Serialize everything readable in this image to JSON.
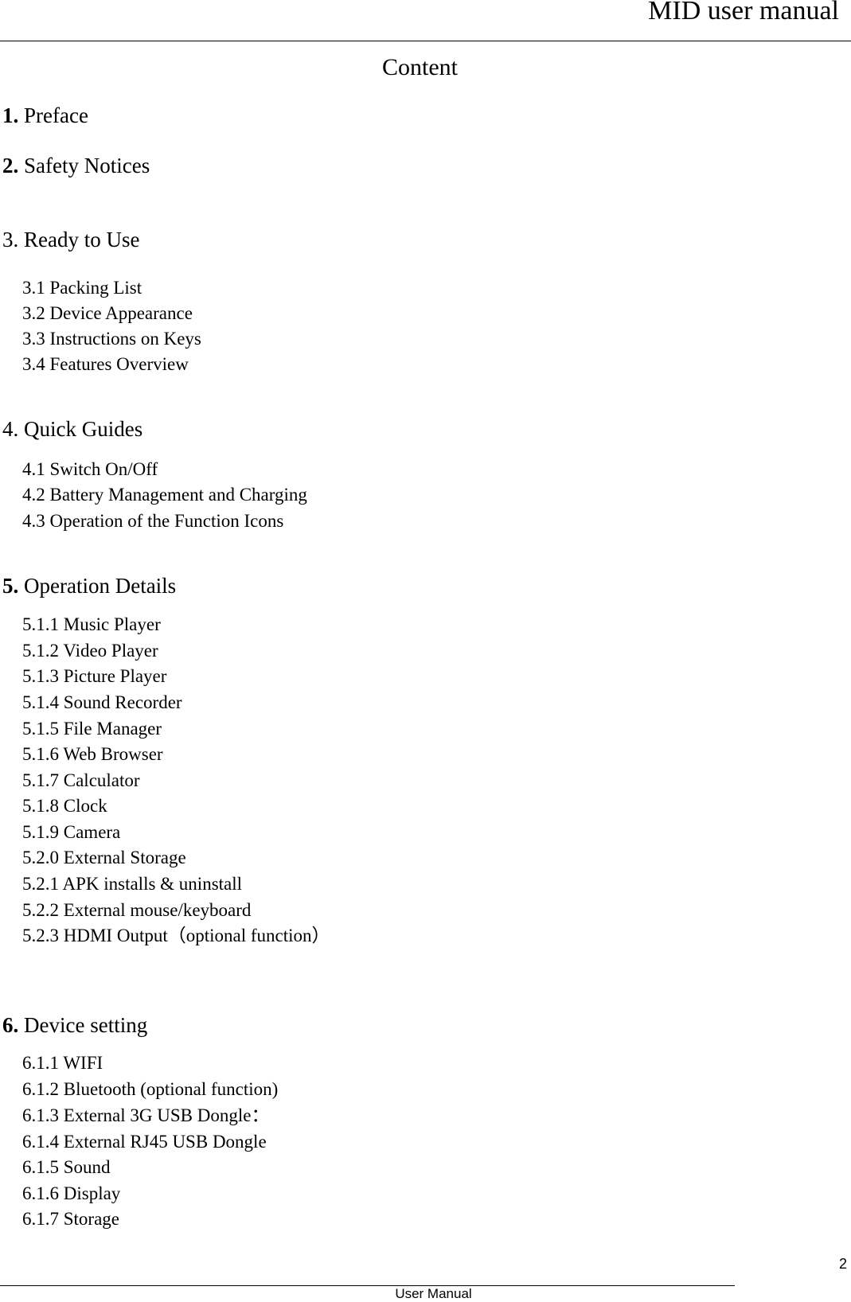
{
  "header": {
    "title": "MID user manual"
  },
  "toc": {
    "title": "Content",
    "sections": [
      {
        "number": "1.",
        "number_bold": true,
        "title": "Preface",
        "items": []
      },
      {
        "number": "2.",
        "number_bold": true,
        "title": "Safety Notices",
        "items": []
      },
      {
        "number": "3.",
        "number_bold": false,
        "title": "Ready to Use",
        "items": [
          "3.1 Packing List",
          "3.2 Device Appearance",
          "3.3 Instructions on Keys",
          "3.4 Features Overview"
        ]
      },
      {
        "number": "4.",
        "number_bold": false,
        "title": "Quick Guides",
        "items": [
          "4.1 Switch On/Off",
          "4.2 Battery Management and Charging",
          "4.3 Operation of the Function Icons"
        ]
      },
      {
        "number": "5.",
        "number_bold": true,
        "title": "Operation Details",
        "items": [
          "5.1.1 Music Player",
          "5.1.2 Video Player",
          "5.1.3 Picture Player",
          "5.1.4 Sound Recorder",
          "5.1.5 File Manager",
          "5.1.6 Web Browser",
          "5.1.7 Calculator",
          "5.1.8 Clock",
          "5.1.9 Camera",
          "5.2.0 External Storage",
          "5.2.1 APK installs & uninstall",
          "5.2.2 External mouse/keyboard",
          "5.2.3 HDMI Output（optional function）"
        ]
      },
      {
        "number": "6.",
        "number_bold": true,
        "title": "Device setting",
        "items": [
          "6.1.1 WIFI",
          "6.1.2 Bluetooth (optional function)",
          "6.1.3 External 3G USB Dongle：",
          "6.1.4 External RJ45 USB Dongle",
          "6.1.5 Sound",
          "6.1.6 Display",
          "6.1.7 Storage"
        ]
      }
    ]
  },
  "footer": {
    "page_number": "2",
    "text": "User Manual"
  }
}
